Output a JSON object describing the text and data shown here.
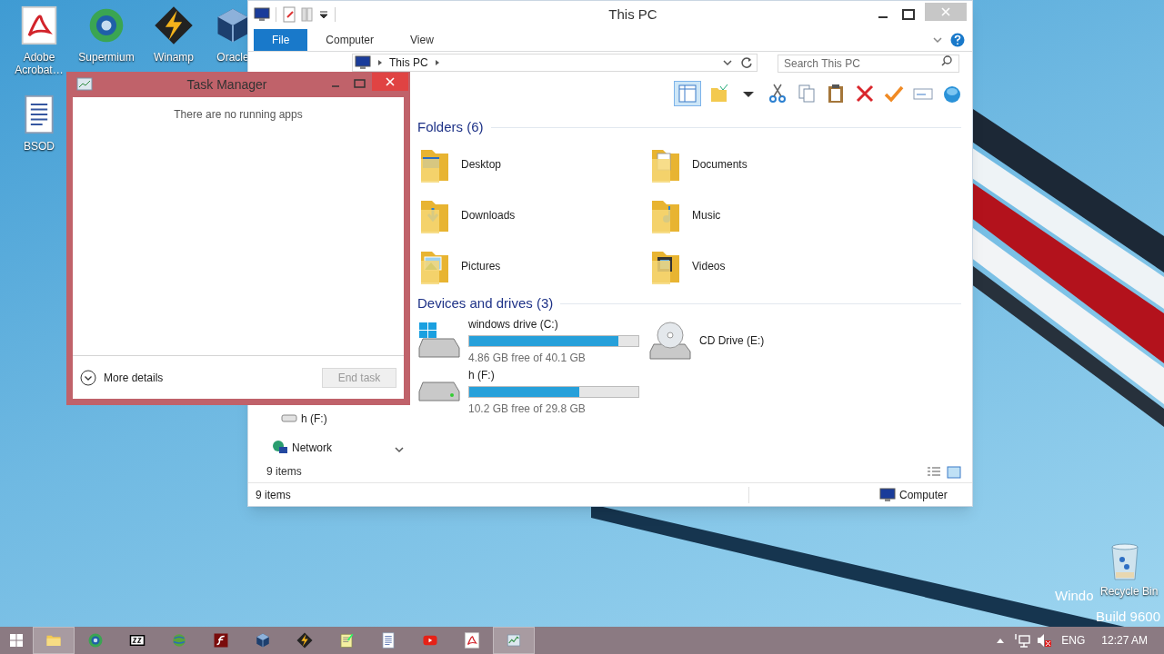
{
  "desktop_icons": [
    {
      "label": "Adobe Acrobat…",
      "kind": "pdf"
    },
    {
      "label": "Supermium",
      "kind": "browser"
    },
    {
      "label": "Winamp",
      "kind": "winamp"
    },
    {
      "label": "Oracle",
      "kind": "box"
    },
    {
      "label": "BSOD",
      "kind": "doc"
    }
  ],
  "explorer": {
    "title": "This PC",
    "ribbon_tabs": [
      {
        "label": "File",
        "kind": "file"
      },
      {
        "label": "Computer",
        "kind": "tab"
      },
      {
        "label": "View",
        "kind": "tab"
      }
    ],
    "address": {
      "crumb": "This PC"
    },
    "search": {
      "placeholder": "Search This PC"
    },
    "groups": [
      {
        "title": "Folders (6)",
        "kind": "folders",
        "items": [
          {
            "name": "Desktop",
            "kind": "desktop"
          },
          {
            "name": "Documents",
            "kind": "documents"
          },
          {
            "name": "Downloads",
            "kind": "downloads"
          },
          {
            "name": "Music",
            "kind": "music"
          },
          {
            "name": "Pictures",
            "kind": "pictures"
          },
          {
            "name": "Videos",
            "kind": "videos"
          }
        ]
      },
      {
        "title": "Devices and drives (3)",
        "kind": "drives",
        "items": [
          {
            "name": "windows drive (C:)",
            "kind": "system",
            "free": "4.86 GB free of 40.1 GB",
            "level": 0.88
          },
          {
            "name": "CD Drive (E:)",
            "kind": "cd"
          },
          {
            "name": "h (F:)",
            "kind": "disk",
            "free": "10.2 GB free of 29.8 GB",
            "level": 0.65
          }
        ]
      }
    ],
    "nav_pane": {
      "items": [
        {
          "label": "h (F:)",
          "kind": "drive"
        },
        {
          "label": "Network",
          "kind": "network"
        }
      ],
      "count": "9 items"
    },
    "status_bar": {
      "count": "9 items",
      "location": "Computer"
    }
  },
  "task_manager": {
    "title": "Task Manager",
    "message": "There are no running apps",
    "more_details": "More details",
    "end_task": {
      "label": "End task",
      "disabled": true
    }
  },
  "recycle_bin": {
    "label": "Recycle Bin"
  },
  "os_build": {
    "line_1": "Windo",
    "line_2": "Build 9600"
  },
  "taskbar": {
    "apps": [
      {
        "kind": "explorer",
        "selected": true
      },
      {
        "kind": "browser",
        "selected": false
      },
      {
        "kind": "zip",
        "selected": false
      },
      {
        "kind": "globe",
        "selected": false
      },
      {
        "kind": "flash",
        "selected": false
      },
      {
        "kind": "box",
        "selected": false
      },
      {
        "kind": "winamp",
        "selected": false
      },
      {
        "kind": "notepad",
        "selected": false
      },
      {
        "kind": "doc",
        "selected": false
      },
      {
        "kind": "youtube",
        "selected": false
      },
      {
        "kind": "pdf",
        "selected": false
      },
      {
        "kind": "taskmgr",
        "selected": true
      }
    ],
    "tray": {
      "language": "ENG",
      "time": "12:27 AM"
    }
  }
}
